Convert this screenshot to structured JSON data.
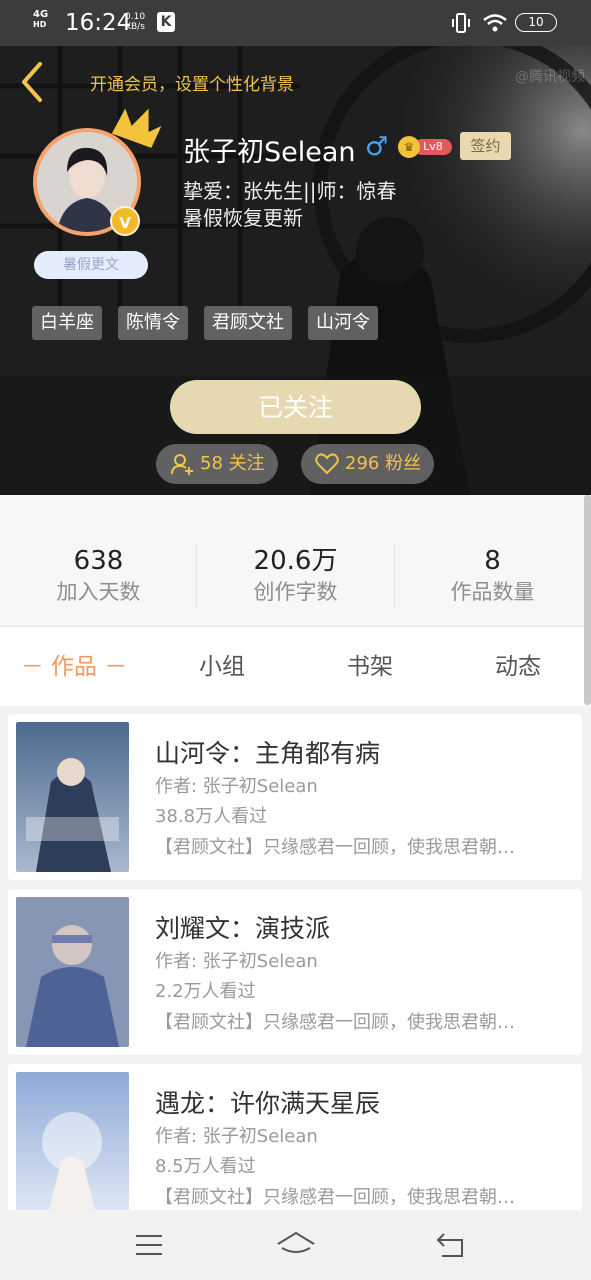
{
  "status_bar": {
    "network": "4G",
    "network_sub": "HD",
    "time": "16:24",
    "speed_value": "0.10",
    "speed_unit": "KB/s",
    "app_icon": "K",
    "battery": "10"
  },
  "header": {
    "vip_hint": "开通会员，设置个性化背景",
    "watermark": "@腾讯视频",
    "avatar_badge": "V",
    "summer_badge": "暑假更文",
    "username": "张子初Selean",
    "gender_symbol": "♂",
    "level": "Lv8",
    "sign_tag": "签约",
    "bio_line1": "挚爱：张先生||师：惊春",
    "bio_line2": "暑假恢复更新",
    "tags": [
      "白羊座",
      "陈情令",
      "君顾文社",
      "山河令"
    ],
    "follow_button": "已关注",
    "following_label": "58 关注",
    "fans_label": "296 粉丝"
  },
  "stats": [
    {
      "value": "638",
      "label": "加入天数"
    },
    {
      "value": "20.6万",
      "label": "创作字数"
    },
    {
      "value": "8",
      "label": "作品数量"
    }
  ],
  "tabs": [
    "－ 作品 －",
    "小组",
    "书架",
    "动态"
  ],
  "works": [
    {
      "title": "山河令：主角都有病",
      "author": "作者: 张子初Selean",
      "views": "38.8万人看过",
      "desc": "【君顾文社】只缘感君一回顾，使我思君朝…"
    },
    {
      "title": "刘耀文：演技派",
      "author": "作者: 张子初Selean",
      "views": "2.2万人看过",
      "desc": "【君顾文社】只缘感君一回顾，使我思君朝…"
    },
    {
      "title": "遇龙：许你满天星辰",
      "author": "作者: 张子初Selean",
      "views": "8.5万人看过",
      "desc": "【君顾文社】只缘感君一回顾，使我思君朝…"
    }
  ],
  "colors": {
    "accent": "#f39a5a",
    "gold": "#f0c44a",
    "follow_button": "#e6d9b1"
  }
}
